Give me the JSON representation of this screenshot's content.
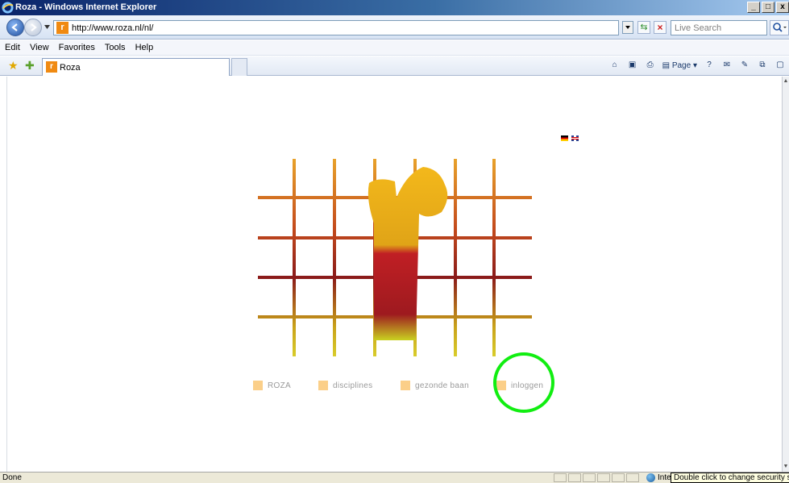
{
  "window": {
    "title": "Roza - Windows Internet Explorer",
    "controls": [
      "_",
      "□",
      "x"
    ]
  },
  "address": {
    "url": "http://www.roza.nl/nl/",
    "favicon_letter": "r",
    "search_placeholder": "Live Search"
  },
  "menu": [
    "Edit",
    "View",
    "Favorites",
    "Tools",
    "Help"
  ],
  "tab": {
    "label": "Roza",
    "icon_letter": "r"
  },
  "command_bar": {
    "page_label": "Page",
    "icons": [
      "home-icon",
      "feeds-icon",
      "print-icon",
      "page-icon",
      "help-icon",
      "mail-icon",
      "research-icon",
      "translate-icon",
      "clipboard-icon"
    ]
  },
  "content": {
    "languages": [
      "de",
      "en"
    ],
    "nav": [
      {
        "label": "ROZA"
      },
      {
        "label": "disciplines"
      },
      {
        "label": "gezonde baan"
      },
      {
        "label": "inloggen"
      }
    ],
    "brand_colors": {
      "nav_square": "#fbcf89",
      "nav_text": "#9a9a9a",
      "highlight": "#11ee11"
    }
  },
  "status": {
    "text": "Done",
    "zone_label": "Inte",
    "tooltip": "Double click to change security settings"
  }
}
